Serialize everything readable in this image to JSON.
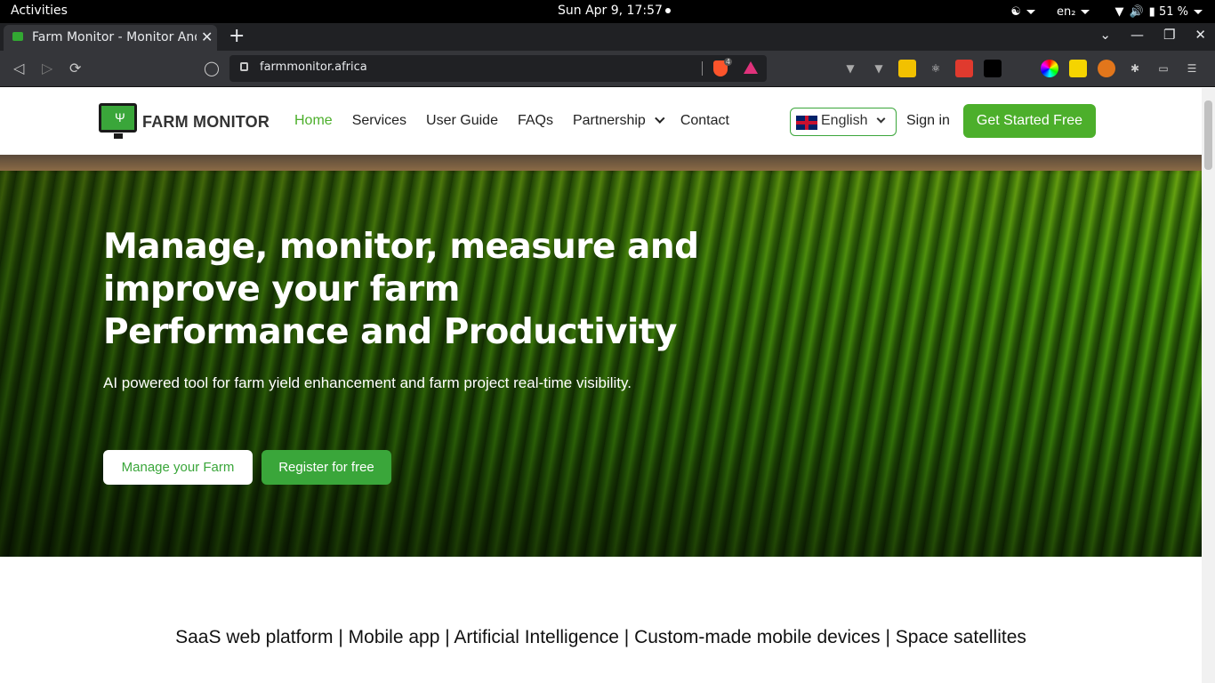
{
  "system": {
    "activities": "Activities",
    "clock": "Sun Apr  9, 17:57",
    "keyboard": "en₂",
    "battery": "51 %"
  },
  "browser": {
    "tab_title": "Farm Monitor - Monitor And",
    "new_tab": "+",
    "url": "farmmonitor.africa",
    "brave_shield_count": "4"
  },
  "site": {
    "logo_text": "FARM MONITOR",
    "nav": [
      "Home",
      "Services",
      "User Guide",
      "FAQs",
      "Partnership",
      "Contact"
    ],
    "language": "English",
    "sign_in": "Sign in",
    "get_started": "Get Started Free"
  },
  "hero": {
    "headline": "Manage, monitor, measure and improve your farm Performance and Productivity",
    "subtitle": "AI powered tool for farm yield enhancement and farm project real-time visibility.",
    "btn_manage": "Manage your Farm",
    "btn_register": "Register for free"
  },
  "tagline": "SaaS web platform | Mobile app | Artificial Intelligence | Custom-made mobile devices | Space satellites",
  "colors": {
    "brand_green": "#4caf2b",
    "topbar": "#000000",
    "browser_chrome": "#35363a"
  }
}
